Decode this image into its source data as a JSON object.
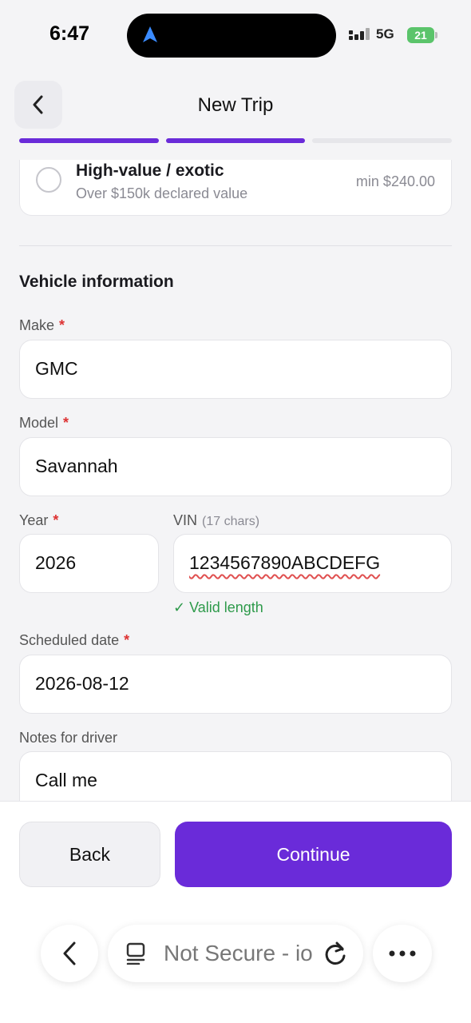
{
  "status_bar": {
    "time": "6:47",
    "network": "5G",
    "battery": "21"
  },
  "header": {
    "title": "New Trip",
    "progress_steps": 3,
    "progress_completed": 2,
    "accent_color": "#6a2bd9",
    "inactive_color": "#e6e6ea"
  },
  "value_option": {
    "title": "High-value / exotic",
    "subtitle": "Over $150k declared value",
    "price": "min $240.00",
    "selected": false
  },
  "vehicle": {
    "section_title": "Vehicle information",
    "make": {
      "label": "Make",
      "required_mark": "*",
      "value": "GMC"
    },
    "model": {
      "label": "Model",
      "required_mark": "*",
      "value": "Savannah"
    },
    "year": {
      "label": "Year",
      "required_mark": "*",
      "value": "2026"
    },
    "vin": {
      "label": "VIN",
      "hint": "(17 chars)",
      "value": "1234567890ABCDEFG",
      "validation": "✓ Valid length"
    },
    "scheduled_date": {
      "label": "Scheduled date",
      "required_mark": "*",
      "value": "2026-08-12"
    },
    "notes": {
      "label": "Notes for driver",
      "value": "Call me"
    }
  },
  "footer": {
    "back_label": "Back",
    "continue_label": "Continue"
  },
  "browser": {
    "url_text": "Not Secure - io"
  }
}
